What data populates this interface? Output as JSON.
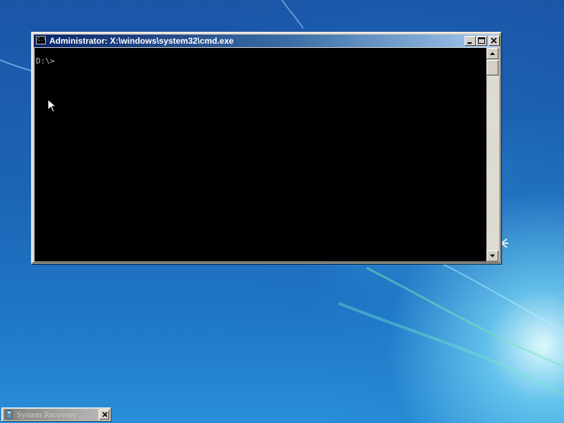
{
  "desktop": {
    "wallpaper": "windows-7-default-blue",
    "accent_color": "#1f6fc2"
  },
  "cmd_window": {
    "title": "Administrator: X:\\windows\\system32\\cmd.exe",
    "icon_glyph": "C:\\",
    "console_text": "D:\\>",
    "text_color": "#c0c0c0",
    "background_color": "#000000",
    "buttons": {
      "minimize_icon": "minimize-icon",
      "maximize_icon": "maximize-icon",
      "close_icon": "close-icon"
    }
  },
  "minimized_window": {
    "title": "System Recovery ...",
    "close_icon": "close-icon"
  },
  "cursor": {
    "icon": "mouse-pointer-icon"
  }
}
